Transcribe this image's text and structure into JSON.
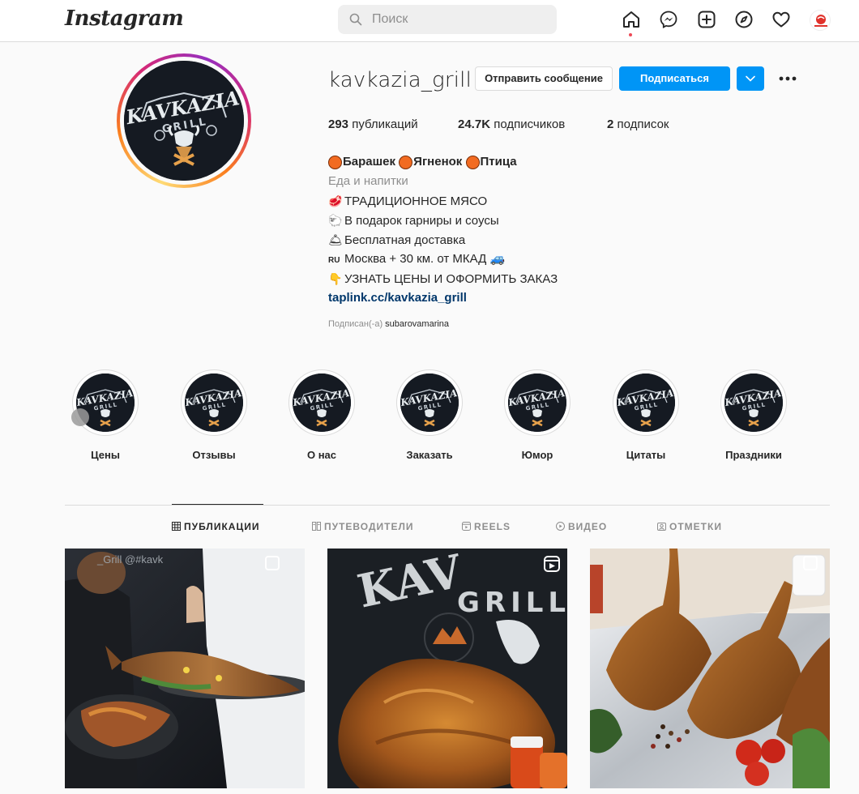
{
  "nav": {
    "logo": "Instagram",
    "search_placeholder": "Поиск"
  },
  "profile": {
    "username": "kavkazia_grill",
    "message_button": "Отправить сообщение",
    "follow_button": "Подписаться",
    "stats": {
      "posts_count": "293",
      "posts_label": "публикаций",
      "followers_count": "24.7K",
      "followers_label": "подписчиков",
      "following_count": "2",
      "following_label": "подписок"
    },
    "bio": {
      "name_parts": [
        "Барашек",
        "Ягненок",
        "Птица"
      ],
      "category": "Еда и напитки",
      "lines": [
        {
          "icon": "🥩",
          "text": "ТРАДИЦИОННОЕ МЯСО"
        },
        {
          "icon": "🐑",
          "text": "В подарок гарниры и соусы"
        },
        {
          "icon": "🛎",
          "text": "Бесплатная доставка"
        },
        {
          "icon": "RU",
          "text": "Москва + 30 км. от МКАД 🚙"
        },
        {
          "icon": "👇",
          "text": "УЗНАТЬ ЦЕНЫ И ОФОРМИТЬ ЗАКАЗ"
        }
      ],
      "link": "taplink.cc/kavkazia_grill",
      "followed_by_prefix": "Подписан(-а)",
      "followed_by_user": "subarovamarina"
    },
    "logo_text": {
      "main": "KAVKAZIA",
      "sub": "GRILL"
    }
  },
  "highlights": [
    {
      "label": "Цены"
    },
    {
      "label": "Отзывы"
    },
    {
      "label": "О нас"
    },
    {
      "label": "Заказать"
    },
    {
      "label": "Юмор"
    },
    {
      "label": "Цитаты"
    },
    {
      "label": "Праздники"
    }
  ],
  "tabs": [
    {
      "label": "ПУБЛИКАЦИИ",
      "icon": "grid-icon",
      "active": true
    },
    {
      "label": "ПУТЕВОДИТЕЛИ",
      "icon": "guide-icon",
      "active": false
    },
    {
      "label": "REELS",
      "icon": "reels-icon",
      "active": false
    },
    {
      "label": "ВИДЕО",
      "icon": "video-icon",
      "active": false
    },
    {
      "label": "ОТМЕТКИ",
      "icon": "tagged-icon",
      "active": false
    }
  ],
  "posts": [
    {
      "type": "carousel",
      "overlay_text": "_Grill  @#kavk"
    },
    {
      "type": "reel",
      "overlay_text": "GRILL"
    },
    {
      "type": "carousel",
      "overlay_text": ""
    }
  ],
  "colors": {
    "accent": "#0095f6",
    "bio_dot": "#f26b21",
    "link": "#00376b"
  }
}
